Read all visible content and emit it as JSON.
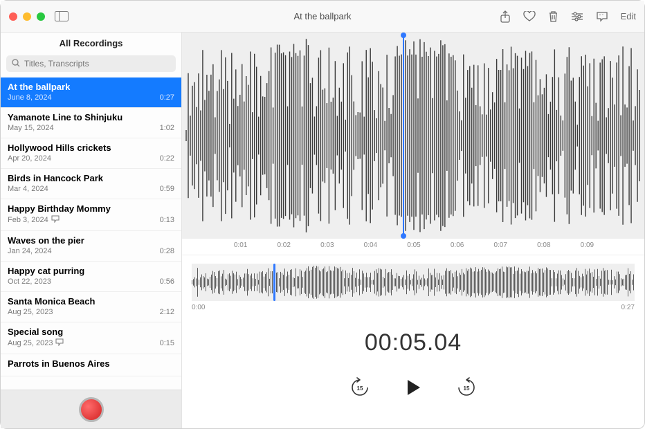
{
  "window": {
    "title": "At the ballpark"
  },
  "toolbar": {
    "edit_label": "Edit"
  },
  "sidebar": {
    "header": "All Recordings",
    "search_placeholder": "Titles, Transcripts",
    "items": [
      {
        "title": "At the ballpark",
        "date": "June 8, 2024",
        "duration": "0:27",
        "selected": true,
        "transcript": false
      },
      {
        "title": "Yamanote Line to Shinjuku",
        "date": "May 15, 2024",
        "duration": "1:02",
        "selected": false,
        "transcript": false
      },
      {
        "title": "Hollywood Hills crickets",
        "date": "Apr 20, 2024",
        "duration": "0:22",
        "selected": false,
        "transcript": false
      },
      {
        "title": "Birds in Hancock Park",
        "date": "Mar 4, 2024",
        "duration": "0:59",
        "selected": false,
        "transcript": false
      },
      {
        "title": "Happy Birthday Mommy",
        "date": "Feb 3, 2024",
        "duration": "0:13",
        "selected": false,
        "transcript": true
      },
      {
        "title": "Waves on the pier",
        "date": "Jan 24, 2024",
        "duration": "0:28",
        "selected": false,
        "transcript": false
      },
      {
        "title": "Happy cat purring",
        "date": "Oct 22, 2023",
        "duration": "0:56",
        "selected": false,
        "transcript": false
      },
      {
        "title": "Santa Monica Beach",
        "date": "Aug 25, 2023",
        "duration": "2:12",
        "selected": false,
        "transcript": false
      },
      {
        "title": "Special song",
        "date": "Aug 25, 2023",
        "duration": "0:15",
        "selected": false,
        "transcript": true
      },
      {
        "title": "Parrots in Buenos Aires",
        "date": "",
        "duration": "",
        "selected": false,
        "transcript": false
      }
    ]
  },
  "ruler": {
    "ticks": [
      "0:01",
      "0:02",
      "0:03",
      "0:04",
      "0:05",
      "0:06",
      "0:07",
      "0:08",
      "0:09"
    ]
  },
  "overview": {
    "start": "0:00",
    "end": "0:27",
    "playhead_ratio": 0.185
  },
  "timecode": "00:05.04",
  "skip_amount": "15",
  "colors": {
    "accent": "#147bff"
  }
}
